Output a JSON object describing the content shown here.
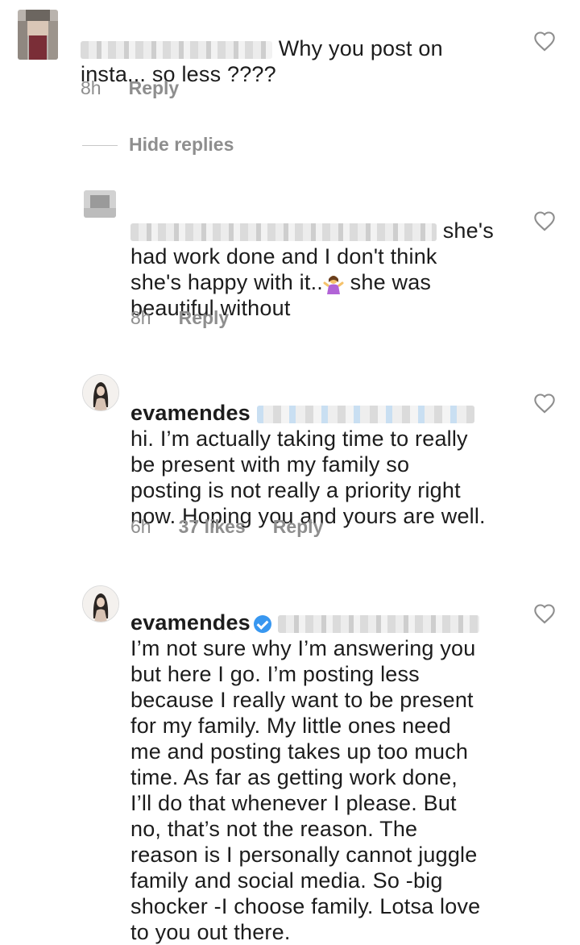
{
  "comments": [
    {
      "username": "",
      "text_line1": "Why you post on",
      "text_rest": "insta... so less ????",
      "time": "8h",
      "reply_label": "Reply"
    },
    {
      "username": "",
      "text_line1": "she's",
      "text_rest": "had work done and I don't think\nshe's happy with it..",
      "text_after_emoji": " she was\nbeautiful without",
      "emoji": "woman-shrugging-emoji",
      "time": "8h",
      "reply_label": "Reply"
    },
    {
      "username": "evamendes",
      "text": "hi. I’m actually taking time to really\nbe present with my family so\nposting is not really a priority right\nnow. Hoping you and yours are well.",
      "time": "6h",
      "likes": "37 likes",
      "reply_label": "Reply"
    },
    {
      "username": "evamendes",
      "verified": true,
      "text": "I’m not sure why I’m answering you\nbut here I go. I’m posting less\nbecause I really want to be present\nfor my family. My little ones need\nme and posting takes up too much\ntime. As far as getting work done,\nI’ll do that whenever I please. But\nno, that’s not the reason. The\nreason is I personally cannot juggle\nfamily and social media. So -big\nshocker -I choose family. Lotsa love\nto you out there."
    }
  ],
  "thread": {
    "hide_replies_label": "Hide replies"
  },
  "colors": {
    "text": "#1c1c1c",
    "meta": "#8e8e8e",
    "verified": "#3897f0"
  },
  "icons": [
    "heart-outline-icon",
    "verified-badge-icon",
    "woman-shrugging-emoji"
  ]
}
